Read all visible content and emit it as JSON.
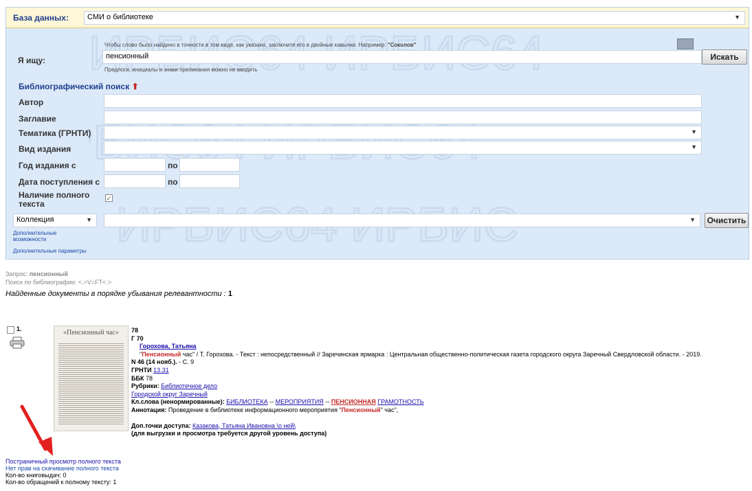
{
  "database": {
    "label": "База данных:",
    "value": "СМИ о библиотеке"
  },
  "search": {
    "label": "Я ищу:",
    "hint_top_prefix": "Чтобы слово было найдено в точности в том виде, как указано, заключите его в двойные кавычки. Например: ",
    "hint_top_example": "\"Соколов\"",
    "value": "пенсионный",
    "hint_bottom": "Предлоги, инициалы и знаки препинания можно не вводить",
    "button": "Искать"
  },
  "biblio": {
    "title": "Библиографический поиск",
    "author": "Автор",
    "title_field": "Заглавие",
    "theme": "Тематика (ГРНТИ)",
    "type": "Вид издания",
    "year_from": "Год издания с",
    "date_from": "Дата поступления с",
    "to": "по",
    "fulltext": "Наличие полного текста",
    "collection": "Коллекция",
    "clear": "Очистить",
    "more1": "Дополнительные возможности",
    "more2": "Дополнительные параметры"
  },
  "query": {
    "label": "Запрос:",
    "value": "пенсионный",
    "biblio_search": "Поиск по библиографии: <.>V=FT<.>",
    "found_text": "Найденные документы в порядке убывания релевантности :",
    "found_count": "1"
  },
  "record": {
    "number": "1.",
    "thumb_title": "«Пенсионный час»",
    "code1": "78",
    "code2": "Г 70",
    "author": "Горохова, Татьяна",
    "title_hl": "Пенсионный",
    "title_rest": " час\" / Т. Горохова. - Текст : непосредственный // Заречинская ярмарка : Центральная общественно-политическая газета городского округа Заречный Свердловской области. - 2019.",
    "issue": "N 46 (14 нояб.).",
    "page": " - С. 9",
    "grnti_label": "ГРНТИ",
    "grnti_value": "13.31",
    "bbk_label": "ББК",
    "bbk_value": "78",
    "rubrics_label": "Рубрики:",
    "rubric1": "Библиотечное дело",
    "rubric2": "Городской округ Заречный",
    "kw_label": "Кл.слова (ненормированные):",
    "kw1": "БИБЛИОТЕКА",
    "kw2": "МЕРОПРИЯТИЯ",
    "kw3": "ПЕНСИОННАЯ",
    "kw4": "ГРАМОТНОСТЬ",
    "sep": " -- ",
    "annot_label": "Аннотация:",
    "annot_text": " Проведение в библиотеке информационного мероприятия \"",
    "annot_hl": "Пенсионный",
    "annot_end": "\" час\",",
    "access_label": "Доп.точки доступа:",
    "access_value": "Казакова, Татьяна Ивановна \\о ней\\",
    "access_note": "(для выгрузки и просмотра требуется другой уровень доступа)"
  },
  "footer": {
    "line1": "Постраничный просмотр полного текста",
    "line2": "Нет прав на скачивание полного текста",
    "line3": "Кол-во книговыдач: 0",
    "line4": "Кол-во обращений к полному тексту: 1"
  },
  "colors": {
    "panel": "#dce9f8",
    "title": "#1f3f8f",
    "highlight": "#c62828",
    "arrow": "#e32020"
  }
}
